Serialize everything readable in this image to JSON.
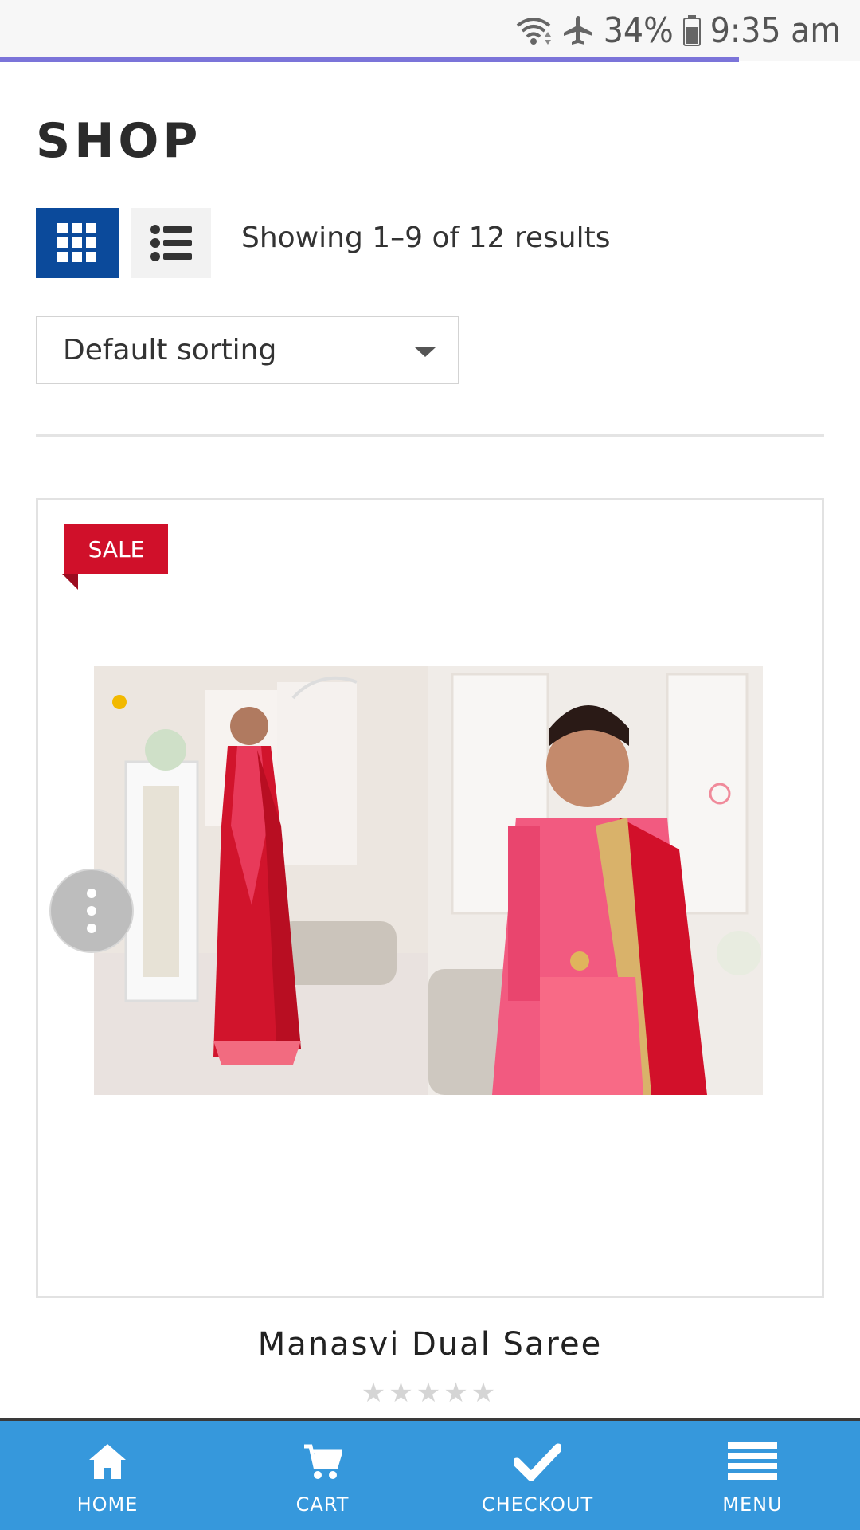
{
  "status_bar": {
    "battery": "34%",
    "time": "9:35 am"
  },
  "page": {
    "title": "SHOP",
    "results_text": "Showing 1–9 of 12 results",
    "sort_selected": "Default sorting"
  },
  "product": {
    "badge": "SALE",
    "name": "Manasvi Dual Saree",
    "rating": 0,
    "rating_max": 5
  },
  "bottom_nav": {
    "items": [
      {
        "label": "HOME",
        "icon": "home-icon"
      },
      {
        "label": "CART",
        "icon": "cart-icon"
      },
      {
        "label": "CHECKOUT",
        "icon": "check-icon"
      },
      {
        "label": "MENU",
        "icon": "menu-icon"
      }
    ]
  },
  "colors": {
    "accent": "#0b4a9b",
    "nav_bar": "#3698dc",
    "sale_badge": "#d0102a",
    "loading_bar": "#7b74d9"
  }
}
